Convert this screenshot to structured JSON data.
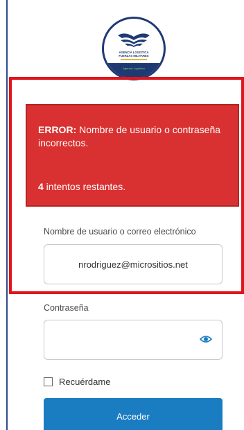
{
  "logo": {
    "icon": "eagle-emblem-icon",
    "text_lines": [
      "AGENCIA LOGISTICA",
      "FUERZAS MILITARES"
    ],
    "band_text": "Agencia Logística"
  },
  "error": {
    "prefix": "ERROR:",
    "message": " Nombre de usuario o contraseña incorrectos.",
    "attempts_count": "4",
    "attempts_text": " intentos restantes."
  },
  "username": {
    "label": "Nombre de usuario o correo electrónico",
    "value": "nrodriguez@micrositios.net"
  },
  "password": {
    "label": "Contraseña",
    "value": "",
    "toggle_icon": "eye-icon"
  },
  "remember": {
    "label": "Recuérdame",
    "checked": false
  },
  "submit": {
    "label": "Acceder"
  },
  "colors": {
    "error_bg": "#d93131",
    "highlight": "#e0151b",
    "primary": "#1a7cc1",
    "logo_navy": "#1f3a73"
  }
}
